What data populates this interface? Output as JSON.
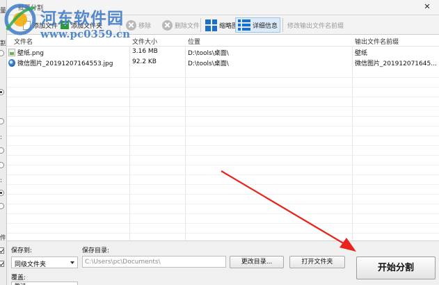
{
  "window": {
    "title": "批量分割"
  },
  "toolbar": {
    "add_file": "添加文件",
    "add_folder": "添加文件夹",
    "remove": "移除",
    "delete_file": "删除文件",
    "thumbnail": "缩略图",
    "detail_info": "详细信息",
    "modify_prefix": "修改输出文件名前缀"
  },
  "table": {
    "columns": [
      "文件名",
      "文件大小",
      "位置",
      "输出文件名前缀"
    ],
    "rows": [
      {
        "name": "壁纸.png",
        "size": "3.16 MB",
        "location": "D:\\tools\\桌面\\",
        "prefix": "壁纸",
        "icon": "png-file-icon"
      },
      {
        "name": "微信图片_20191207164553.jpg",
        "size": "92.2 KB",
        "location": "D:\\tools\\桌面\\",
        "prefix": "微信图片_201912071645...",
        "icon": "jpg-file-icon"
      }
    ]
  },
  "bottom": {
    "save_to_label": "保存到:",
    "save_to_value": "同级文件夹",
    "save_dir_label": "保存目录:",
    "save_dir_value": "C:\\Users\\pc\\Documents\\",
    "change_dir_button": "更改目录...",
    "open_folder_button": "打开文件夹",
    "start_button": "开始分割",
    "overwrite_label": "覆盖:",
    "overwrite_value": "跳过"
  },
  "watermark": {
    "title": "河东软件园",
    "url": "www.pc0359.cn"
  },
  "colors": {
    "accent_blue": "#1a70c9",
    "annotation_arrow": "#e8231c",
    "watermark": "#3d7ac7"
  }
}
